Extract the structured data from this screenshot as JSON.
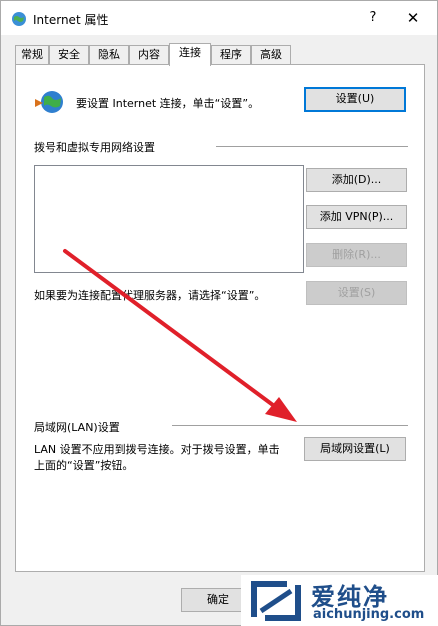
{
  "window": {
    "title": "Internet 属性",
    "help": "?",
    "close": "✕"
  },
  "tabs": [
    {
      "label": "常规"
    },
    {
      "label": "安全"
    },
    {
      "label": "隐私"
    },
    {
      "label": "内容"
    },
    {
      "label": "连接",
      "active": true
    },
    {
      "label": "程序"
    },
    {
      "label": "高级"
    }
  ],
  "setup": {
    "text": "要设置 Internet 连接，单击“设置”。",
    "button": "设置(U)"
  },
  "dialup": {
    "heading": "拨号和虚拟专用网络设置",
    "add": "添加(D)...",
    "add_vpn": "添加 VPN(P)...",
    "remove": "删除(R)...",
    "proxy_text": "如果要为连接配置代理服务器，请选择“设置”。",
    "settings": "设置(S)"
  },
  "lan": {
    "heading": "局域网(LAN)设置",
    "text_line1": "LAN 设置不应用到拨号连接。对于拨号设置，单击",
    "text_line2": "上面的“设置”按钮。",
    "button": "局域网设置(L)"
  },
  "footer": {
    "ok": "确定"
  },
  "watermark": {
    "title": "爱纯净",
    "url": "aichunjing.com"
  },
  "colors": {
    "accent": "#0078d7",
    "arrow": "#e0202a",
    "watermark": "#1f4e8a"
  }
}
